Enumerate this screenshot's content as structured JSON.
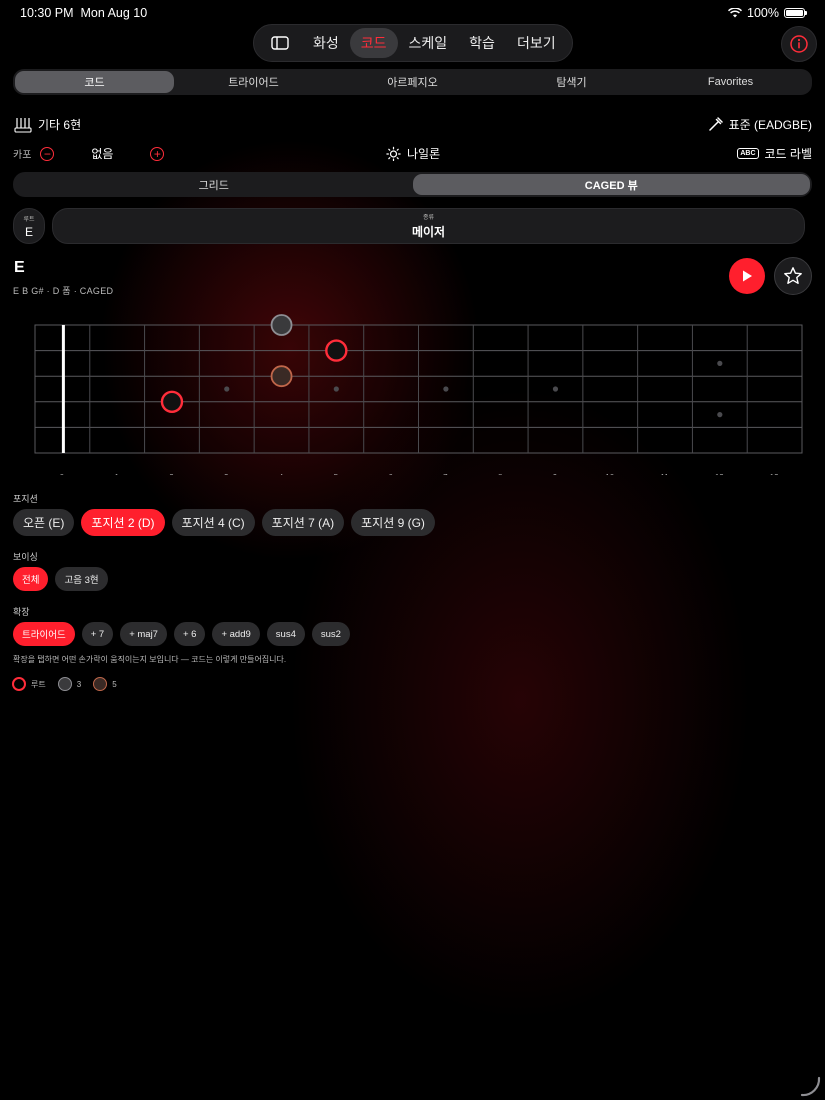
{
  "status": {
    "time": "10:30 PM",
    "date": "Mon Aug 10",
    "battery": "100%"
  },
  "nav": {
    "tabs": [
      {
        "label": "화성",
        "active": false
      },
      {
        "label": "코드",
        "active": true
      },
      {
        "label": "스케일",
        "active": false
      },
      {
        "label": "학습",
        "active": false
      },
      {
        "label": "더보기",
        "active": false
      }
    ]
  },
  "subtabs": [
    "코드",
    "트라이어드",
    "아르페지오",
    "탐색기",
    "Favorites"
  ],
  "subtab_active": 0,
  "instrument": {
    "name": "기타 6현",
    "tuning": "표준 (EADGBE)"
  },
  "capo": {
    "label": "카포",
    "value": "없음"
  },
  "handed": "나일론",
  "chord_label": "코드 라벨",
  "view_toggle": [
    "그리드",
    "CAGED 뷰"
  ],
  "view_active": 1,
  "root": {
    "label": "루트",
    "value": "E"
  },
  "quality": {
    "label": "종류",
    "value": "메이저"
  },
  "chord": {
    "name": "E",
    "notes": "E  B  G#   ·   D 폼 · CAGED"
  },
  "fretboard": {
    "fret_numbers": [
      "0",
      "1",
      "2",
      "3",
      "4",
      "5",
      "6",
      "7",
      "8",
      "9",
      "10",
      "11",
      "12",
      "13"
    ],
    "inlays": [
      3,
      5,
      7,
      9
    ],
    "double_inlay": 12,
    "notes": [
      {
        "fret": 4,
        "string": 0,
        "role": "third"
      },
      {
        "fret": 5,
        "string": 1,
        "role": "root"
      },
      {
        "fret": 4,
        "string": 2,
        "role": "fifth"
      },
      {
        "fret": 2,
        "string": 3,
        "role": "root"
      }
    ]
  },
  "colors": {
    "accent": "#ff1f2d",
    "root": "#ff2d3a",
    "third": "#8e8e93",
    "fifth": "#c0674a"
  },
  "positions": {
    "label": "포지션",
    "items": [
      "오픈 (E)",
      "포지션 2 (D)",
      "포지션 4 (C)",
      "포지션 7 (A)",
      "포지션 9 (G)"
    ],
    "active": 1
  },
  "voicing": {
    "label": "보이싱",
    "items": [
      "전체",
      "고음 3현"
    ],
    "active": 0
  },
  "extensions": {
    "label": "확장",
    "items": [
      "트라이어드",
      "+ 7",
      "+ maj7",
      "+ 6",
      "+ add9",
      "sus4",
      "sus2"
    ],
    "active": 0,
    "hint": "확장을 탭하면 어떤 손가락이 움직이는지 보입니다 — 코드는 이렇게 만들어집니다."
  },
  "legend": [
    {
      "label": "루트",
      "role": "root"
    },
    {
      "label": "3",
      "role": "third"
    },
    {
      "label": "5",
      "role": "fifth"
    }
  ]
}
